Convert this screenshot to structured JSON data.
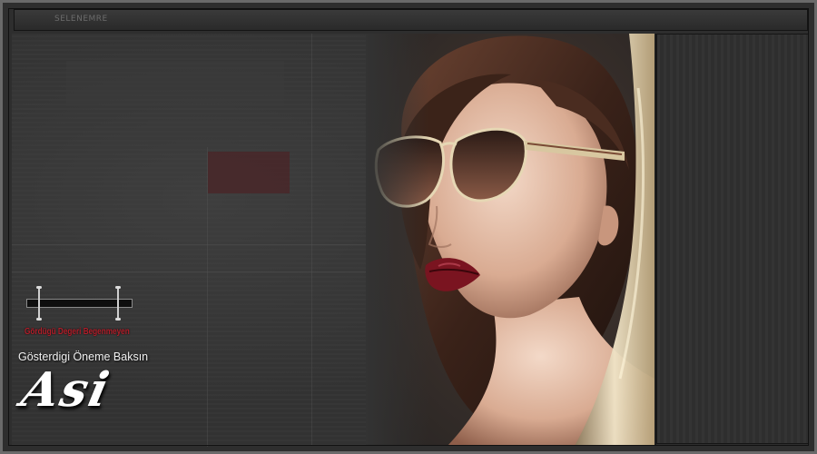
{
  "header": {
    "title": "SELENEMRE"
  },
  "taglines": {
    "red": "Gördügü Degeri Begenmeyen",
    "white": "Gösterdigi Öneme Baksın"
  },
  "signature": {
    "text": "Asi"
  },
  "colors": {
    "background": "#2e2e2e",
    "frame_border": "#6a6a6a",
    "accent_red": "#b21e2a",
    "lip_red": "#7a1420",
    "sunglass_gold": "#d8c7a0"
  },
  "icons": {
    "portrait": "woman-with-sunglasses-illustration",
    "slider": "slider-widget"
  }
}
